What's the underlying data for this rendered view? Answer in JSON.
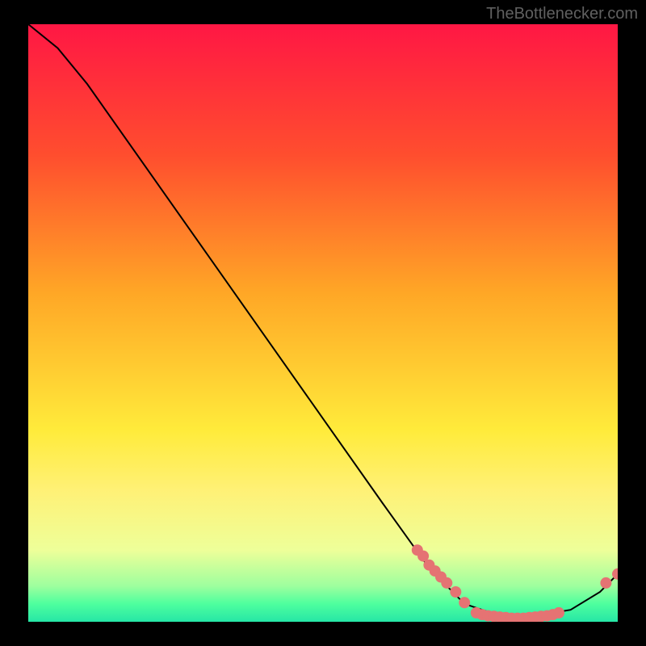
{
  "watermark": "TheBottlenecker.com",
  "chart_data": {
    "type": "line",
    "title": "",
    "xlabel": "",
    "ylabel": "",
    "xlim": [
      0,
      100
    ],
    "ylim": [
      0,
      100
    ],
    "gradient_stops": [
      {
        "offset": 0,
        "color": "#ff1744"
      },
      {
        "offset": 22,
        "color": "#ff4e2e"
      },
      {
        "offset": 45,
        "color": "#ffa726"
      },
      {
        "offset": 68,
        "color": "#ffeb3b"
      },
      {
        "offset": 78,
        "color": "#fff176"
      },
      {
        "offset": 88,
        "color": "#eeff99"
      },
      {
        "offset": 94,
        "color": "#9eff9e"
      },
      {
        "offset": 97,
        "color": "#4eff9e"
      },
      {
        "offset": 100,
        "color": "#26e6a6"
      }
    ],
    "curve": [
      {
        "x": 0,
        "y": 100
      },
      {
        "x": 5,
        "y": 96
      },
      {
        "x": 10,
        "y": 90
      },
      {
        "x": 20,
        "y": 76
      },
      {
        "x": 30,
        "y": 62
      },
      {
        "x": 40,
        "y": 48
      },
      {
        "x": 50,
        "y": 34
      },
      {
        "x": 60,
        "y": 20
      },
      {
        "x": 68,
        "y": 9
      },
      {
        "x": 74,
        "y": 3
      },
      {
        "x": 80,
        "y": 1
      },
      {
        "x": 86,
        "y": 1
      },
      {
        "x": 92,
        "y": 2
      },
      {
        "x": 97,
        "y": 5
      },
      {
        "x": 100,
        "y": 8
      }
    ],
    "markers": [
      {
        "x": 66,
        "y": 12
      },
      {
        "x": 67,
        "y": 11
      },
      {
        "x": 68,
        "y": 9.5
      },
      {
        "x": 69,
        "y": 8.5
      },
      {
        "x": 70,
        "y": 7.5
      },
      {
        "x": 71,
        "y": 6.5
      },
      {
        "x": 72.5,
        "y": 5
      },
      {
        "x": 74,
        "y": 3.2
      },
      {
        "x": 76,
        "y": 1.5
      },
      {
        "x": 77,
        "y": 1.2
      },
      {
        "x": 78,
        "y": 1.0
      },
      {
        "x": 79,
        "y": 0.9
      },
      {
        "x": 80,
        "y": 0.8
      },
      {
        "x": 81,
        "y": 0.7
      },
      {
        "x": 82,
        "y": 0.6
      },
      {
        "x": 83,
        "y": 0.6
      },
      {
        "x": 84,
        "y": 0.6
      },
      {
        "x": 85,
        "y": 0.7
      },
      {
        "x": 86,
        "y": 0.8
      },
      {
        "x": 87,
        "y": 0.9
      },
      {
        "x": 88,
        "y": 1.0
      },
      {
        "x": 89,
        "y": 1.2
      },
      {
        "x": 90,
        "y": 1.5
      },
      {
        "x": 98,
        "y": 6.5
      },
      {
        "x": 100,
        "y": 8
      }
    ],
    "marker_color": "#e57373",
    "marker_radius": 7,
    "line_color": "#000000"
  }
}
